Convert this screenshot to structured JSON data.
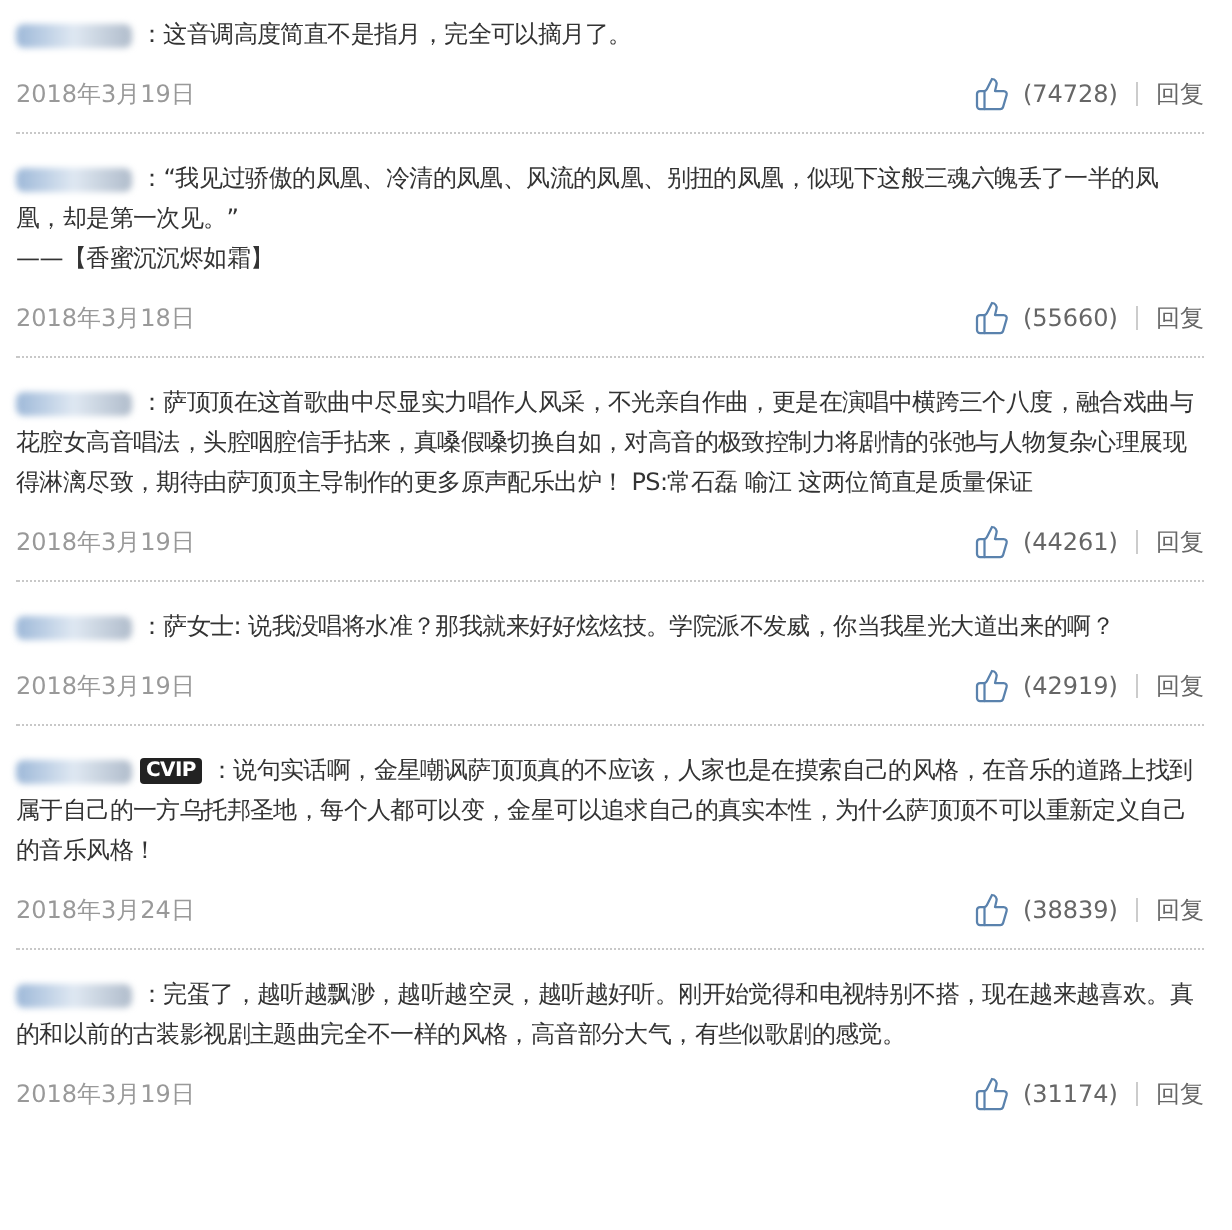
{
  "comments": [
    {
      "lines": [
        "：这音调高度简直不是指月，完全可以摘月了。"
      ],
      "date": "2018年3月19日",
      "likes": "(74728)",
      "reply": "回复"
    },
    {
      "lines": [
        "：“我见过骄傲的凤凰、冷清的凤凰、风流的凤凰、别扭的凤凰，似现下这般三魂六魄丢了一半的凤凰，却是第一次见。”",
        "——【香蜜沉沉烬如霜】"
      ],
      "date": "2018年3月18日",
      "likes": "(55660)",
      "reply": "回复"
    },
    {
      "lines": [
        "：萨顶顶在这首歌曲中尽显实力唱作人风采，不光亲自作曲，更是在演唱中横跨三个八度，融合戏曲与花腔女高音唱法，头腔咽腔信手拈来，真嗓假嗓切换自如，对高音的极致控制力将剧情的张弛与人物复杂心理展现得淋漓尽致，期待由萨顶顶主导制作的更多原声配乐出炉！ PS:常石磊 喻江 这两位简直是质量保证"
      ],
      "date": "2018年3月19日",
      "likes": "(44261)",
      "reply": "回复"
    },
    {
      "lines": [
        "：萨女士: 说我没唱将水准？那我就来好好炫炫技。学院派不发威，你当我星光大道出来的啊？"
      ],
      "date": "2018年3月19日",
      "likes": "(42919)",
      "reply": "回复"
    },
    {
      "badge": "CVIP",
      "lines": [
        "：说句实话啊，金星嘲讽萨顶顶真的不应该，人家也是在摸索自己的风格，在音乐的道路上找到属于自己的一方乌托邦圣地，每个人都可以变，金星可以追求自己的真实本性，为什么萨顶顶不可以重新定义自己的音乐风格！"
      ],
      "date": "2018年3月24日",
      "likes": "(38839)",
      "reply": "回复"
    },
    {
      "lines": [
        "：完蛋了，越听越飘渺，越听越空灵，越听越好听。刚开始觉得和电视特别不搭，现在越来越喜欢。真的和以前的古装影视剧主题曲完全不一样的风格，高音部分大气，有些似歌剧的感觉。"
      ],
      "date": "2018年3月19日",
      "likes": "(31174)",
      "reply": "回复"
    }
  ]
}
